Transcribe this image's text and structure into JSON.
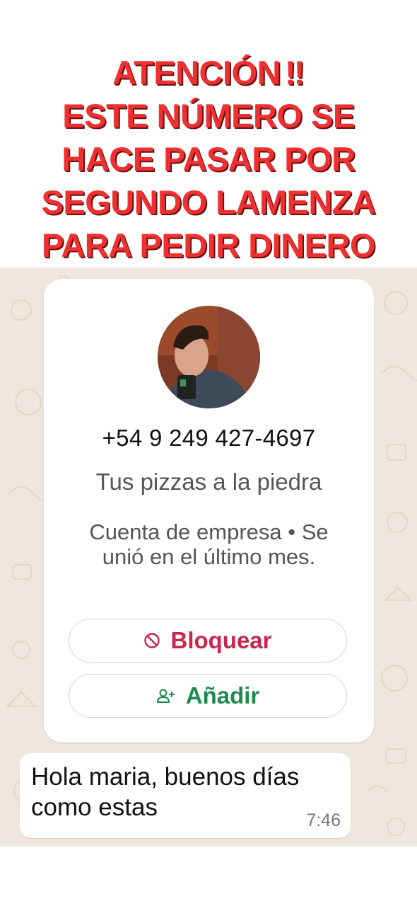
{
  "warning": {
    "lines": [
      "ATENCIÓN",
      "ESTE NÚMERO SE",
      "HACE PASAR POR",
      "SEGUNDO LAMENZA",
      "PARA PEDIR DINERO"
    ],
    "alert_icon": "‼",
    "color": "#ef3030"
  },
  "contact": {
    "avatar_icon": "profile-photo",
    "phone": "+54 9 249 427-4697",
    "about": "Tus pizzas a la piedra",
    "account_info": "Cuenta de empresa • Se unió en el último mes.",
    "block_label": "Bloquear",
    "add_label": "Añadir",
    "block_color": "#c7274d",
    "add_color": "#1f8a4c"
  },
  "message": {
    "text": "Hola maria, buenos días como estas",
    "time": "7:46"
  },
  "colors": {
    "chat_background": "#efe7dd"
  }
}
